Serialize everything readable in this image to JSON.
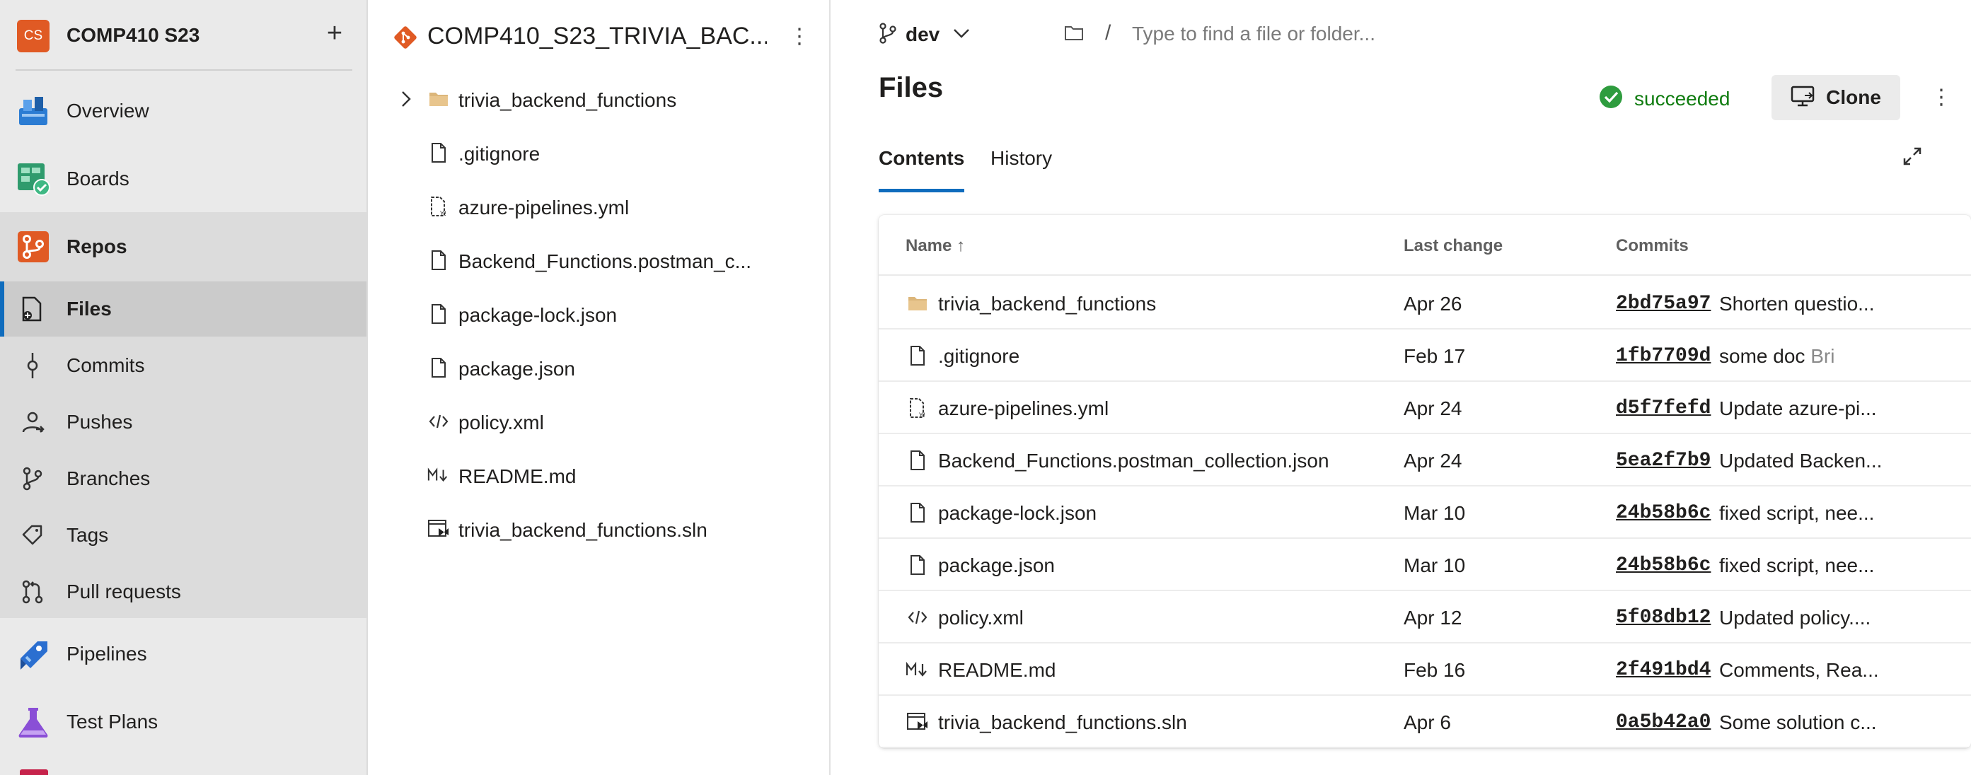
{
  "project": {
    "initials": "CS",
    "name": "COMP410 S23",
    "add_label": "+"
  },
  "nav": {
    "overview": "Overview",
    "boards": "Boards",
    "repos": "Repos",
    "files": "Files",
    "commits": "Commits",
    "pushes": "Pushes",
    "branches": "Branches",
    "tags": "Tags",
    "pull_requests": "Pull requests",
    "pipelines": "Pipelines",
    "test_plans": "Test Plans"
  },
  "repo": {
    "name": "COMP410_S23_TRIVIA_BAC...",
    "more": "⋮",
    "tree": [
      {
        "label": "trivia_backend_functions",
        "icon": "folder-icon"
      },
      {
        "label": ".gitignore",
        "icon": "file-icon"
      },
      {
        "label": "azure-pipelines.yml",
        "icon": "yaml-file-icon"
      },
      {
        "label": "Backend_Functions.postman_c...",
        "icon": "file-icon"
      },
      {
        "label": "package-lock.json",
        "icon": "file-icon"
      },
      {
        "label": "package.json",
        "icon": "file-icon"
      },
      {
        "label": "policy.xml",
        "icon": "code-icon"
      },
      {
        "label": "README.md",
        "icon": "markdown-icon"
      },
      {
        "label": "trivia_backend_functions.sln",
        "icon": "solution-icon"
      }
    ]
  },
  "toolbar": {
    "branch": "dev",
    "path_sep": "/",
    "search_placeholder": "Type to find a file or folder..."
  },
  "main": {
    "title": "Files",
    "status": "succeeded",
    "clone_label": "Clone",
    "more": "⋮",
    "tabs": [
      "Contents",
      "History"
    ]
  },
  "table": {
    "headers": {
      "name": "Name ↑",
      "last_change": "Last change",
      "commits": "Commits"
    },
    "rows": [
      {
        "name": "trivia_backend_functions",
        "icon": "folder-icon",
        "date": "Apr 26",
        "hash": "2bd75a97",
        "msg": "Shorten questio...",
        "author": ""
      },
      {
        "name": ".gitignore",
        "icon": "file-icon",
        "date": "Feb 17",
        "hash": "1fb7709d",
        "msg": "some doc",
        "author": "Bri"
      },
      {
        "name": "azure-pipelines.yml",
        "icon": "yaml-file-icon",
        "date": "Apr 24",
        "hash": "d5f7fefd",
        "msg": "Update azure-pi...",
        "author": ""
      },
      {
        "name": "Backend_Functions.postman_collection.json",
        "icon": "file-icon",
        "date": "Apr 24",
        "hash": "5ea2f7b9",
        "msg": "Updated Backen...",
        "author": ""
      },
      {
        "name": "package-lock.json",
        "icon": "file-icon",
        "date": "Mar 10",
        "hash": "24b58b6c",
        "msg": "fixed script, nee...",
        "author": ""
      },
      {
        "name": "package.json",
        "icon": "file-icon",
        "date": "Mar 10",
        "hash": "24b58b6c",
        "msg": "fixed script, nee...",
        "author": ""
      },
      {
        "name": "policy.xml",
        "icon": "code-icon",
        "date": "Apr 12",
        "hash": "5f08db12",
        "msg": "Updated policy....",
        "author": ""
      },
      {
        "name": "README.md",
        "icon": "markdown-icon",
        "date": "Feb 16",
        "hash": "2f491bd4",
        "msg": "Comments, Rea...",
        "author": ""
      },
      {
        "name": "trivia_backend_functions.sln",
        "icon": "solution-icon",
        "date": "Apr 6",
        "hash": "0a5b42a0",
        "msg": "Some solution c...",
        "author": ""
      }
    ]
  },
  "colors": {
    "accent": "#0f6cbd",
    "success": "#107c10",
    "project_avatar": "#e05a24",
    "git_logo": "#e05a24"
  }
}
